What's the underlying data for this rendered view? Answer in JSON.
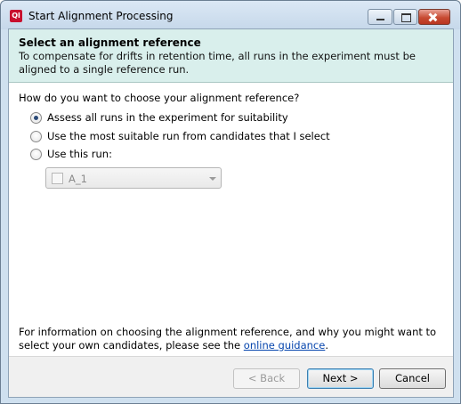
{
  "window": {
    "title": "Start Alignment Processing",
    "icon_label": "Ql"
  },
  "header": {
    "title": "Select an alignment reference",
    "description": "To compensate for drifts in retention time, all runs in the experiment must be aligned to a single reference run."
  },
  "question": "How do you want to choose your alignment reference?",
  "options": [
    {
      "label": "Assess all runs in the experiment for suitability",
      "checked": true
    },
    {
      "label": "Use the most suitable run from candidates that I select",
      "checked": false
    },
    {
      "label": "Use this run:",
      "checked": false
    }
  ],
  "run_select": {
    "value": "A_1",
    "enabled": false
  },
  "footer": {
    "info_prefix": "For information on choosing the alignment reference, and why you might want to select your own candidates, please see the ",
    "link_text": "online guidance",
    "info_suffix": "."
  },
  "buttons": {
    "back": "< Back",
    "next": "Next >",
    "cancel": "Cancel"
  },
  "colors": {
    "header_bg": "#d9efec",
    "link": "#0645ad",
    "close_button": "#c84b33"
  }
}
